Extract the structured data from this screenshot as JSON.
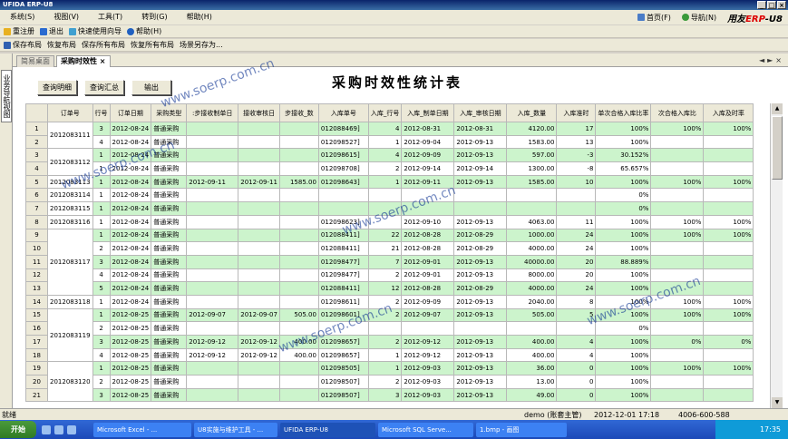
{
  "window": {
    "title": "UFIDA ERP-U8"
  },
  "menu": {
    "items": [
      "系统(S)",
      "视图(V)",
      "工具(T)",
      "转到(G)",
      "帮助(H)"
    ],
    "home": "首页(F)",
    "nav": "导航(N)",
    "logo_a": "用友",
    "logo_b": "ERP",
    "logo_c": "-U8"
  },
  "toolbar1": {
    "items": [
      "重注册",
      "退出",
      "快速使用向导",
      "帮助(H)"
    ]
  },
  "toolbar2": {
    "items": [
      "保存布局",
      "恢复布局",
      "保存所有布局",
      "恢复所有布局",
      "场景另存为..."
    ]
  },
  "sidebar": {
    "tab_label": "业务导航视图"
  },
  "tabs": {
    "home": "简易桌面",
    "active": "采购时效性"
  },
  "buttons": {
    "query_detail": "查询明细",
    "query_summary": "查询汇总",
    "export": "输出"
  },
  "report": {
    "title": "采购时效性统计表"
  },
  "table": {
    "headers": [
      "订单号",
      "行号",
      "订单日期",
      "采购类型",
      ":步接收制单日",
      "接收审核日",
      "步接收_数",
      "入库单号",
      "入库_行号",
      "入库_制单日期",
      "入库_审核日期",
      "入库_数量",
      "入库准时",
      "单次合格入库比率",
      "次合格入库比",
      "入库及时率"
    ],
    "rows": [
      {
        "n": "1",
        "po": "2012083111",
        "ln": "3",
        "d": "2012-08-24",
        "t": "普通采购",
        "a": "",
        "b": "",
        "c": "",
        "rk": "012088469]",
        "rl": "4",
        "md": "2012-08-31",
        "sd": "2012-08-31",
        "q": "4120.00",
        "on": "17",
        "r1": "100%",
        "r2": "100%",
        "r3": "100%",
        "g": true
      },
      {
        "n": "2",
        "po": "",
        "ln": "4",
        "d": "2012-08-24",
        "t": "普通采购",
        "a": "",
        "b": "",
        "c": "",
        "rk": "012098527]",
        "rl": "1",
        "md": "2012-09-04",
        "sd": "2012-09-13",
        "q": "1583.00",
        "on": "13",
        "r1": "100%",
        "r2": "",
        "r3": "",
        "g": false
      },
      {
        "n": "3",
        "po": "2012083112",
        "ln": "1",
        "d": "2012-08-24",
        "t": "普通采购",
        "a": "",
        "b": "",
        "c": "",
        "rk": "012098615]",
        "rl": "4",
        "md": "2012-09-09",
        "sd": "2012-09-13",
        "q": "597.00",
        "on": "-3",
        "r1": "30.152%",
        "r2": "",
        "r3": "",
        "g": true
      },
      {
        "n": "4",
        "po": "",
        "ln": "1",
        "d": "2012-08-24",
        "t": "普通采购",
        "a": "",
        "b": "",
        "c": "",
        "rk": "012098708]",
        "rl": "2",
        "md": "2012-09-14",
        "sd": "2012-09-14",
        "q": "1300.00",
        "on": "-8",
        "r1": "65.657%",
        "r2": "",
        "r3": "",
        "g": false
      },
      {
        "n": "5",
        "po": "2012083113",
        "ln": "1",
        "d": "2012-08-24",
        "t": "普通采购",
        "a": "2012-09-11",
        "b": "2012-09-11",
        "c": "1585.00",
        "rk": "012098643]",
        "rl": "1",
        "md": "2012-09-11",
        "sd": "2012-09-13",
        "q": "1585.00",
        "on": "10",
        "r1": "100%",
        "r2": "100%",
        "r3": "100%",
        "g": true
      },
      {
        "n": "6",
        "po": "2012083114",
        "ln": "1",
        "d": "2012-08-24",
        "t": "普通采购",
        "a": "",
        "b": "",
        "c": "",
        "rk": "",
        "rl": "",
        "md": "",
        "sd": "",
        "q": "",
        "on": "",
        "r1": "0%",
        "r2": "",
        "r3": "",
        "g": false
      },
      {
        "n": "7",
        "po": "2012083115",
        "ln": "1",
        "d": "2012-08-24",
        "t": "普通采购",
        "a": "",
        "b": "",
        "c": "",
        "rk": "",
        "rl": "",
        "md": "",
        "sd": "",
        "q": "",
        "on": "",
        "r1": "0%",
        "r2": "",
        "r3": "",
        "g": true
      },
      {
        "n": "8",
        "po": "2012083116",
        "ln": "1",
        "d": "2012-08-24",
        "t": "普通采购",
        "a": "",
        "b": "",
        "c": "",
        "rk": "012098623]",
        "rl": "",
        "md": "2012-09-10",
        "sd": "2012-09-13",
        "q": "4063.00",
        "on": "11",
        "r1": "100%",
        "r2": "100%",
        "r3": "100%",
        "g": false
      },
      {
        "n": "9",
        "po": "2012083117",
        "ln": "1",
        "d": "2012-08-24",
        "t": "普通采购",
        "a": "",
        "b": "",
        "c": "",
        "rk": "012088411]",
        "rl": "22",
        "md": "2012-08-28",
        "sd": "2012-08-29",
        "q": "1000.00",
        "on": "24",
        "r1": "100%",
        "r2": "100%",
        "r3": "100%",
        "g": true
      },
      {
        "n": "10",
        "po": "",
        "ln": "2",
        "d": "2012-08-24",
        "t": "普通采购",
        "a": "",
        "b": "",
        "c": "",
        "rk": "012088411]",
        "rl": "21",
        "md": "2012-08-28",
        "sd": "2012-08-29",
        "q": "4000.00",
        "on": "24",
        "r1": "100%",
        "r2": "",
        "r3": "",
        "g": false
      },
      {
        "n": "11",
        "po": "",
        "ln": "3",
        "d": "2012-08-24",
        "t": "普通采购",
        "a": "",
        "b": "",
        "c": "",
        "rk": "012098477]",
        "rl": "7",
        "md": "2012-09-01",
        "sd": "2012-09-13",
        "q": "40000.00",
        "on": "20",
        "r1": "88.889%",
        "r2": "",
        "r3": "",
        "g": true
      },
      {
        "n": "12",
        "po": "",
        "ln": "4",
        "d": "2012-08-24",
        "t": "普通采购",
        "a": "",
        "b": "",
        "c": "",
        "rk": "012098477]",
        "rl": "2",
        "md": "2012-09-01",
        "sd": "2012-09-13",
        "q": "8000.00",
        "on": "20",
        "r1": "100%",
        "r2": "",
        "r3": "",
        "g": false
      },
      {
        "n": "13",
        "po": "",
        "ln": "5",
        "d": "2012-08-24",
        "t": "普通采购",
        "a": "",
        "b": "",
        "c": "",
        "rk": "012088411]",
        "rl": "12",
        "md": "2012-08-28",
        "sd": "2012-08-29",
        "q": "4000.00",
        "on": "24",
        "r1": "100%",
        "r2": "",
        "r3": "",
        "g": true
      },
      {
        "n": "14",
        "po": "2012083118",
        "ln": "1",
        "d": "2012-08-24",
        "t": "普通采购",
        "a": "",
        "b": "",
        "c": "",
        "rk": "012098611]",
        "rl": "2",
        "md": "2012-09-09",
        "sd": "2012-09-13",
        "q": "2040.00",
        "on": "8",
        "r1": "100%",
        "r2": "100%",
        "r3": "100%",
        "g": false
      },
      {
        "n": "15",
        "po": "2012083119",
        "ln": "1",
        "d": "2012-08-25",
        "t": "普通采购",
        "a": "2012-09-07",
        "b": "2012-09-07",
        "c": "505.00",
        "rk": "012098601]",
        "rl": "2",
        "md": "2012-09-07",
        "sd": "2012-09-13",
        "q": "505.00",
        "on": "5",
        "r1": "100%",
        "r2": "100%",
        "r3": "100%",
        "g": true
      },
      {
        "n": "16",
        "po": "",
        "ln": "2",
        "d": "2012-08-25",
        "t": "普通采购",
        "a": "",
        "b": "",
        "c": "",
        "rk": "",
        "rl": "",
        "md": "",
        "sd": "",
        "q": "",
        "on": "",
        "r1": "0%",
        "r2": "",
        "r3": "",
        "g": false
      },
      {
        "n": "17",
        "po": "",
        "ln": "3",
        "d": "2012-08-25",
        "t": "普通采购",
        "a": "2012-09-12",
        "b": "2012-09-12",
        "c": "400.00",
        "rk": "012098657]",
        "rl": "2",
        "md": "2012-09-12",
        "sd": "2012-09-13",
        "q": "400.00",
        "on": "4",
        "r1": "100%",
        "r2": "0%",
        "r3": "0%",
        "g": true
      },
      {
        "n": "18",
        "po": "",
        "ln": "4",
        "d": "2012-08-25",
        "t": "普通采购",
        "a": "2012-09-12",
        "b": "2012-09-12",
        "c": "400.00",
        "rk": "012098657]",
        "rl": "1",
        "md": "2012-09-12",
        "sd": "2012-09-13",
        "q": "400.00",
        "on": "4",
        "r1": "100%",
        "r2": "",
        "r3": "",
        "g": false
      },
      {
        "n": "19",
        "po": "2012083120",
        "ln": "1",
        "d": "2012-08-25",
        "t": "普通采购",
        "a": "",
        "b": "",
        "c": "",
        "rk": "012098505]",
        "rl": "1",
        "md": "2012-09-03",
        "sd": "2012-09-13",
        "q": "36.00",
        "on": "0",
        "r1": "100%",
        "r2": "100%",
        "r3": "100%",
        "g": true
      },
      {
        "n": "20",
        "po": "",
        "ln": "2",
        "d": "2012-08-25",
        "t": "普通采购",
        "a": "",
        "b": "",
        "c": "",
        "rk": "012098507]",
        "rl": "2",
        "md": "2012-09-03",
        "sd": "2012-09-13",
        "q": "13.00",
        "on": "0",
        "r1": "100%",
        "r2": "",
        "r3": "",
        "g": false
      },
      {
        "n": "21",
        "po": "",
        "ln": "3",
        "d": "2012-08-25",
        "t": "普通采购",
        "a": "",
        "b": "",
        "c": "",
        "rk": "012098507]",
        "rl": "3",
        "md": "2012-09-03",
        "sd": "2012-09-13",
        "q": "49.00",
        "on": "0",
        "r1": "100%",
        "r2": "",
        "r3": "",
        "g": true
      }
    ]
  },
  "watermark": "www.soerp.com.cn",
  "status": {
    "left": "就绪",
    "user": "demo (账套主管)",
    "datetime": "2012-12-01 17:18",
    "phone": "4006-600-588"
  },
  "taskbar": {
    "start": "开始",
    "items": [
      "Microsoft Excel - ...",
      "U8实施与维护工具 - ...",
      "UFIDA ERP-U8",
      "Microsoft SQL Serve...",
      "1.bmp - 画图"
    ],
    "clock": "17:35"
  }
}
